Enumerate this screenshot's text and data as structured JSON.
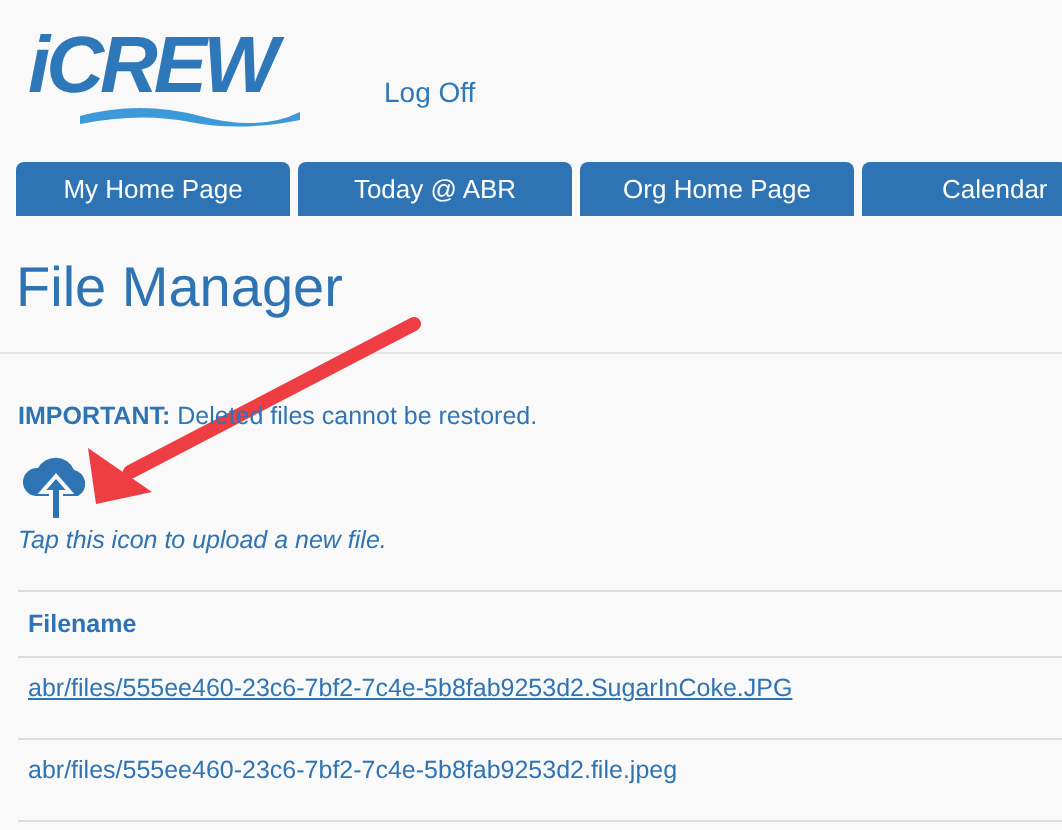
{
  "header": {
    "logo": "iCREW",
    "link": "Log Off"
  },
  "tabs": [
    {
      "label": "My Home Page",
      "selected": false
    },
    {
      "label": "Today @ ABR",
      "selected": false
    },
    {
      "label": "Org Home Page",
      "selected": false
    },
    {
      "label": "Calendar",
      "selected": false
    }
  ],
  "page": {
    "title": "File Manager",
    "notice": "**IMPORTANT:** Deleted files cannot be restored.",
    "upload_hint": "Tap this icon to upload a new file."
  },
  "table": {
    "columns": [
      "Filename"
    ],
    "rows": [
      {
        "filename": "abr/files/555ee460-23c6-7bf2-7c4e-5b8fab9253d2.SugarInCoke.JPG",
        "underlined": true
      },
      {
        "filename": "abr/files/555ee460-23c6-7bf2-7c4e-5b8fab9253d2.file.jpeg",
        "underlined": false
      }
    ]
  }
}
